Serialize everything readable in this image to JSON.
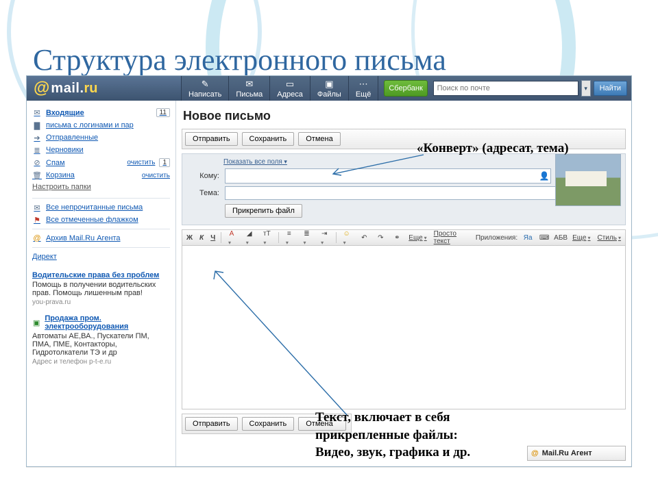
{
  "slide": {
    "title": "Структура электронного письма"
  },
  "logo": {
    "at": "@",
    "name": "mail",
    "dot": ".",
    "tld": "ru"
  },
  "nav": {
    "write": "Написать",
    "letters": "Письма",
    "addresses": "Адреса",
    "files": "Файлы",
    "more": "Ещё",
    "sberbank": "Сбербанк"
  },
  "search": {
    "placeholder": "Поиск по почте",
    "button": "Найти"
  },
  "sidebar": {
    "inbox": "Входящие",
    "inbox_count": "11",
    "logins": "письма с логинами и пар",
    "sent": "Отправленные",
    "drafts": "Черновики",
    "spam": "Спам",
    "spam_clear": "очистить",
    "spam_count": "1",
    "trash": "Корзина",
    "trash_clear": "очистить",
    "configure": "Настроить папки",
    "unread": "Все непрочитанные письма",
    "flagged": "Все отмеченные флажком",
    "archive": "Архив Mail.Ru Агента",
    "direct": "Директ",
    "ad1_title": "Водительские права без проблем",
    "ad1_body": "Помощь в получении водительских прав. Помощь лишенным прав!",
    "ad1_src": "you-prava.ru",
    "ad2_title": "Продажа пром. электрооборудования",
    "ad2_body": "Автоматы АЕ,ВА., Пускатели ПМ, ПМА, ПМЕ, Контакторы, Гидротолкатели ТЭ и др",
    "ad2_src": "Адрес и телефон  p-t-e.ru"
  },
  "compose": {
    "heading": "Новое письмо",
    "send": "Отправить",
    "save": "Сохранить",
    "cancel": "Отмена",
    "show_all": "Показать все поля",
    "to_label": "Кому:",
    "subject_label": "Тема:",
    "attach": "Прикрепить файл"
  },
  "toolbar": {
    "bold": "Ж",
    "italic": "К",
    "underline": "Ч",
    "more": "Еще",
    "plain": "Просто текст",
    "apps": "Приложения:",
    "style": "Стиль"
  },
  "agent": {
    "label": "Mail.Ru Агент"
  },
  "annotations": {
    "envelope": "«Конверт» (адресат, тема)",
    "body1": "Текст, включает в себя",
    "body2": "прикрепленные файлы:",
    "body3": "Видео, звук, графика и др."
  }
}
